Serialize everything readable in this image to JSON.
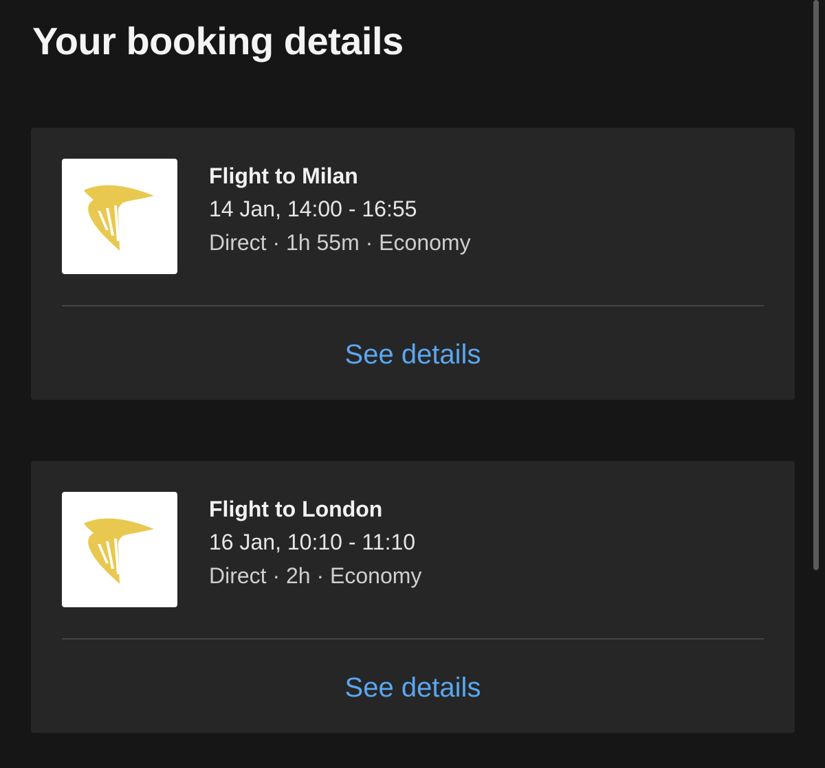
{
  "page": {
    "title": "Your booking details"
  },
  "colors": {
    "background": "#161616",
    "card": "#262626",
    "link": "#5aa7f2",
    "logo": "#e9c84f"
  },
  "bookings": [
    {
      "title": "Flight to Milan",
      "times": "14 Jan, 14:00 - 16:55",
      "meta": "Direct · 1h 55m · Economy",
      "link_label": "See details",
      "logo_icon": "harp-logo-icon"
    },
    {
      "title": "Flight to London",
      "times": "16 Jan, 10:10 - 11:10",
      "meta": "Direct · 2h · Economy",
      "link_label": "See details",
      "logo_icon": "harp-logo-icon"
    }
  ]
}
